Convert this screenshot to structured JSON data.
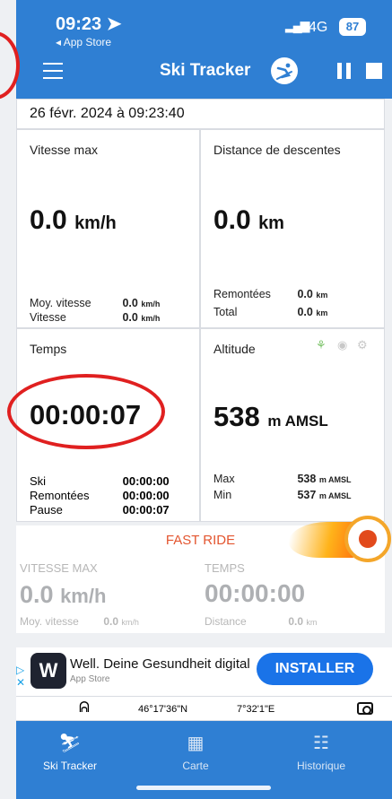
{
  "status_bar": {
    "time": "09:23",
    "back_label": "◂ App Store",
    "network": "4G",
    "battery": "87"
  },
  "header": {
    "title": "Ski Tracker"
  },
  "date_time": "26 févr. 2024 à 09:23:40",
  "cards": {
    "speed": {
      "title": "Vitesse max",
      "value": "0.0",
      "unit": "km/h",
      "rows": [
        {
          "label": "Moy. vitesse",
          "value": "0.0",
          "unit": "km/h"
        },
        {
          "label": "Vitesse",
          "value": "0.0",
          "unit": "km/h"
        }
      ]
    },
    "distance": {
      "title": "Distance de descentes",
      "value": "0.0",
      "unit": "km",
      "rows": [
        {
          "label": "Remontées",
          "value": "0.0",
          "unit": "km"
        },
        {
          "label": "Total",
          "value": "0.0",
          "unit": "km"
        }
      ]
    },
    "time": {
      "title": "Temps",
      "value": "00:00:07",
      "rows": [
        {
          "label": "Ski",
          "value": "00:00:00"
        },
        {
          "label": "Remontées",
          "value": "00:00:00"
        },
        {
          "label": "Pause",
          "value": "00:00:07"
        }
      ]
    },
    "altitude": {
      "title": "Altitude",
      "value": "538",
      "unit": "m AMSL",
      "rows": [
        {
          "label": "Max",
          "value": "538",
          "unit": "m AMSL"
        },
        {
          "label": "Min",
          "value": "537",
          "unit": "m AMSL"
        }
      ]
    }
  },
  "fast_ride": {
    "title": "FAST RIDE",
    "left_label": "VITESSE MAX",
    "left_value": "0.0",
    "left_unit": "km/h",
    "right_label": "TEMPS",
    "right_value": "00:00:00",
    "foot_left_label": "Moy. vitesse",
    "foot_left_value": "0.0",
    "foot_left_unit": "km/h",
    "foot_right_label": "Distance",
    "foot_right_value": "0.0",
    "foot_right_unit": "km"
  },
  "ad": {
    "title": "Well. Deine Gesundheit digital",
    "subtitle": "App Store",
    "button": "INSTALLER",
    "logo_letter": "W"
  },
  "coords": {
    "lat": "46°17'36\"N",
    "lon": "7°32'1\"E"
  },
  "tabs": [
    {
      "label": "Ski Tracker"
    },
    {
      "label": "Carte"
    },
    {
      "label": "Historique"
    }
  ]
}
